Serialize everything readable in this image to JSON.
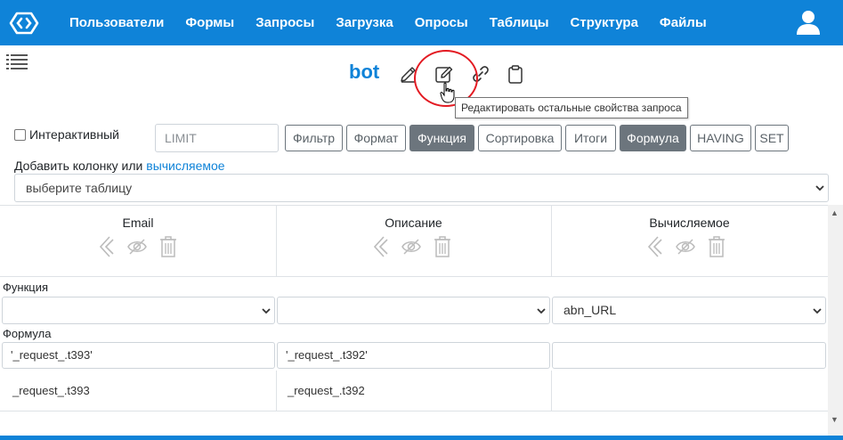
{
  "nav": {
    "items": [
      "Пользователи",
      "Формы",
      "Запросы",
      "Загрузка",
      "Опросы",
      "Таблицы",
      "Структура",
      "Файлы"
    ]
  },
  "query": {
    "title": "bot",
    "tooltip": "Редактировать остальные свойства запроса"
  },
  "controls": {
    "interactive_label": "Интерактивный",
    "limit_placeholder": "LIMIT",
    "buttons": [
      {
        "label": "Фильтр",
        "active": false
      },
      {
        "label": "Формат",
        "active": false
      },
      {
        "label": "Функция",
        "active": true
      },
      {
        "label": "Сортировка",
        "active": false
      },
      {
        "label": "Итоги",
        "active": false
      },
      {
        "label": "Формула",
        "active": true
      },
      {
        "label": "HAVING",
        "active": false
      },
      {
        "label": "SET",
        "active": false
      }
    ],
    "add_column_label": "Добавить колонку или",
    "add_column_link": "вычисляемое",
    "table_select_value": "выберите таблицу"
  },
  "grid": {
    "columns": [
      {
        "header": "Email",
        "function": "",
        "formula": "'_request_.t393'",
        "value": "_request_.t393"
      },
      {
        "header": "Описание",
        "function": "",
        "formula": "'_request_.t392'",
        "value": "_request_.t392"
      },
      {
        "header": "Вычисляемое",
        "function": "abn_URL",
        "formula": "",
        "value": ""
      }
    ],
    "function_label": "Функция",
    "formula_label": "Формула"
  },
  "colors": {
    "brand": "#0f83d8",
    "active_button": "#6c757d",
    "highlight": "#e31b23"
  }
}
